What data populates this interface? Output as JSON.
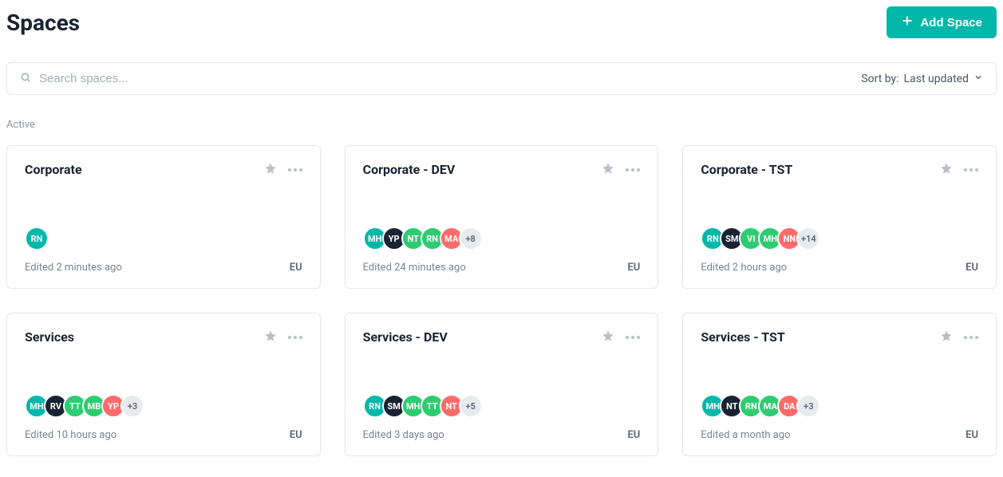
{
  "page": {
    "title": "Spaces",
    "add_button": "Add Space"
  },
  "toolbar": {
    "search_placeholder": "Search spaces...",
    "sort_prefix": "Sort by:",
    "sort_value": "Last updated"
  },
  "section": {
    "label": "Active"
  },
  "colors": {
    "teal": "#00b8a9",
    "navy": "#1a2332",
    "green": "#2ecc71",
    "coral": "#ff6b6b",
    "grey": "#e8ebee"
  },
  "cards": [
    {
      "title": "Corporate",
      "edited": "Edited 2 minutes ago",
      "region": "EU",
      "avatars": [
        {
          "initials": "RN",
          "color": "teal"
        }
      ],
      "more": null
    },
    {
      "title": "Corporate - DEV",
      "edited": "Edited 24 minutes ago",
      "region": "EU",
      "avatars": [
        {
          "initials": "MH",
          "color": "teal"
        },
        {
          "initials": "YP",
          "color": "navy"
        },
        {
          "initials": "NT",
          "color": "green"
        },
        {
          "initials": "RN",
          "color": "green"
        },
        {
          "initials": "MA",
          "color": "coral"
        }
      ],
      "more": "+8"
    },
    {
      "title": "Corporate - TST",
      "edited": "Edited 2 hours ago",
      "region": "EU",
      "avatars": [
        {
          "initials": "RN",
          "color": "teal"
        },
        {
          "initials": "SM",
          "color": "navy"
        },
        {
          "initials": "VI",
          "color": "green"
        },
        {
          "initials": "MH",
          "color": "green"
        },
        {
          "initials": "NN",
          "color": "coral"
        }
      ],
      "more": "+14"
    },
    {
      "title": "Services",
      "edited": "Edited 10 hours ago",
      "region": "EU",
      "avatars": [
        {
          "initials": "MH",
          "color": "teal"
        },
        {
          "initials": "RV",
          "color": "navy"
        },
        {
          "initials": "TT",
          "color": "green"
        },
        {
          "initials": "MB",
          "color": "green"
        },
        {
          "initials": "YP",
          "color": "coral"
        }
      ],
      "more": "+3"
    },
    {
      "title": "Services - DEV",
      "edited": "Edited 3 days ago",
      "region": "EU",
      "avatars": [
        {
          "initials": "RN",
          "color": "teal"
        },
        {
          "initials": "SM",
          "color": "navy"
        },
        {
          "initials": "MH",
          "color": "green"
        },
        {
          "initials": "TT",
          "color": "green"
        },
        {
          "initials": "NT",
          "color": "coral"
        }
      ],
      "more": "+5"
    },
    {
      "title": "Services - TST",
      "edited": "Edited a month ago",
      "region": "EU",
      "avatars": [
        {
          "initials": "MH",
          "color": "teal"
        },
        {
          "initials": "NT",
          "color": "navy"
        },
        {
          "initials": "RN",
          "color": "green"
        },
        {
          "initials": "MA",
          "color": "green"
        },
        {
          "initials": "DA",
          "color": "coral"
        }
      ],
      "more": "+3"
    }
  ]
}
